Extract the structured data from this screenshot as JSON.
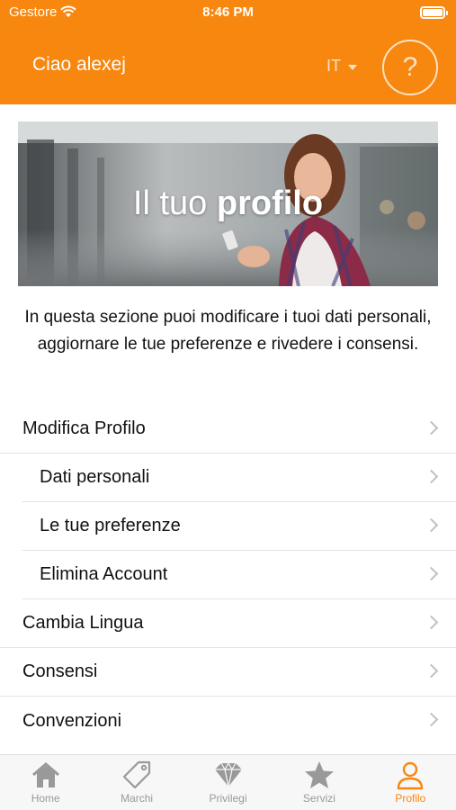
{
  "status_bar": {
    "carrier": "Gestore",
    "time": "8:46 PM"
  },
  "header": {
    "greeting": "Ciao alexej",
    "language": "IT",
    "help_label": "?"
  },
  "hero": {
    "title_thin": "Il tuo ",
    "title_bold": "profilo"
  },
  "intro_text": "In questa sezione puoi modificare i tuoi dati personali, aggiornare le tue preferenze e rivedere i consensi.",
  "menu": {
    "modifica_profilo": "Modifica Profilo",
    "dati_personali": "Dati personali",
    "preferenze": "Le tue preferenze",
    "elimina_account": "Elimina Account",
    "cambia_lingua": "Cambia Lingua",
    "consensi": "Consensi",
    "convenzioni": "Convenzioni"
  },
  "tabs": [
    {
      "label": "Home",
      "icon": "home-icon",
      "active": false
    },
    {
      "label": "Marchi",
      "icon": "tag-icon",
      "active": false
    },
    {
      "label": "Privilegi",
      "icon": "diamond-icon",
      "active": false
    },
    {
      "label": "Servizi",
      "icon": "star-icon",
      "active": false
    },
    {
      "label": "Profilo",
      "icon": "person-icon",
      "active": true
    }
  ],
  "colors": {
    "accent": "#f7870f",
    "inactive_tab": "#999999",
    "chevron": "#c0c0c5"
  }
}
